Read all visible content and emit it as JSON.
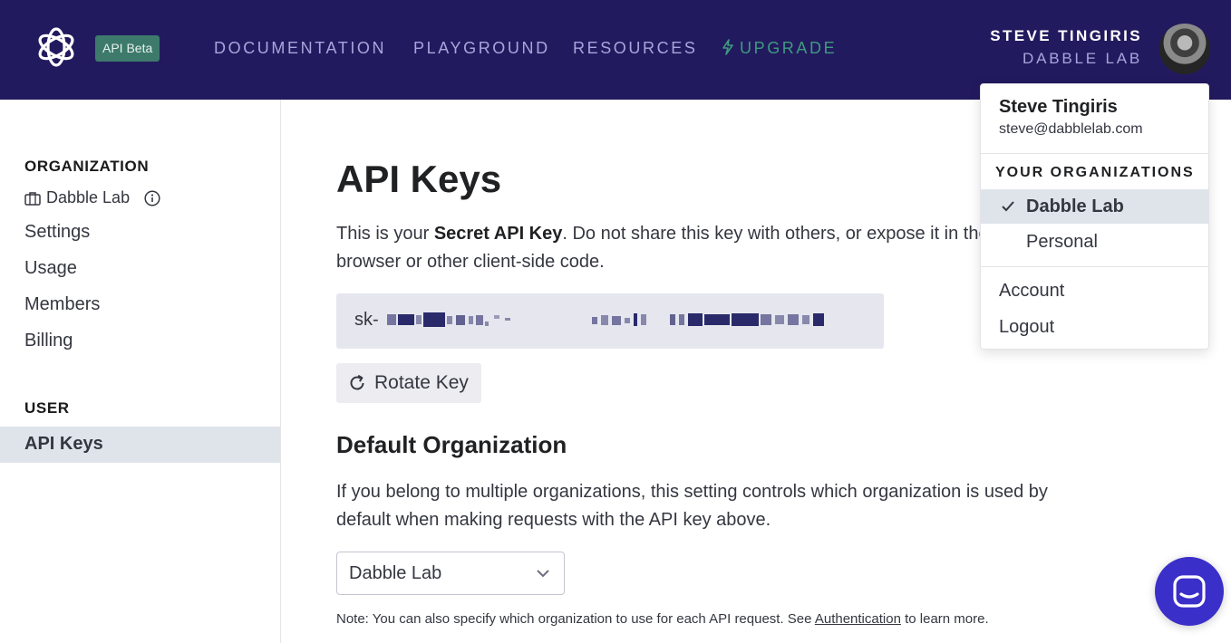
{
  "header": {
    "badge": "API Beta",
    "nav": [
      {
        "label": "DOCUMENTATION"
      },
      {
        "label": "PLAYGROUND"
      },
      {
        "label": "RESOURCES"
      },
      {
        "label": "UPGRADE"
      }
    ],
    "user_name": "STEVE TINGIRIS",
    "user_org": "DABBLE LAB"
  },
  "sidebar": {
    "org_heading": "ORGANIZATION",
    "org_name": "Dabble Lab",
    "items": [
      {
        "label": "Settings"
      },
      {
        "label": "Usage"
      },
      {
        "label": "Members"
      },
      {
        "label": "Billing"
      }
    ],
    "user_heading": "USER",
    "active_item": "API Keys"
  },
  "main": {
    "title": "API Keys",
    "desc_prefix": "This is your ",
    "desc_bold": "Secret API Key",
    "desc_suffix": ". Do not share this key with others, or expose it in the browser or other client-side code.",
    "key_prefix": "sk-",
    "rotate_label": "Rotate Key",
    "default_org_title": "Default Organization",
    "default_org_desc": "If you belong to multiple organizations, this setting controls which organization is used by default when making requests with the API key above.",
    "select_value": "Dabble Lab",
    "note_prefix": "Note: You can also specify which organization to use for each API request. See ",
    "note_link": "Authentication",
    "note_suffix": " to learn more."
  },
  "dropdown": {
    "name": "Steve Tingiris",
    "email": "steve@dabblelab.com",
    "orgs_heading": "YOUR ORGANIZATIONS",
    "orgs": [
      {
        "label": "Dabble Lab",
        "selected": true
      },
      {
        "label": "Personal",
        "selected": false
      }
    ],
    "account_label": "Account",
    "logout_label": "Logout"
  },
  "colors": {
    "header_bg": "#221a5e",
    "nav_text": "#a7a6dc",
    "upgrade": "#3e9a80",
    "badge_bg": "#3d7a6b",
    "active_bg": "#dfe3ea",
    "chat_widget": "#3b2fc9"
  },
  "icons": [
    "openai-logo-icon",
    "bolt-icon",
    "briefcase-icon",
    "info-icon",
    "refresh-icon",
    "chevron-down-icon",
    "check-icon",
    "chat-icon"
  ]
}
